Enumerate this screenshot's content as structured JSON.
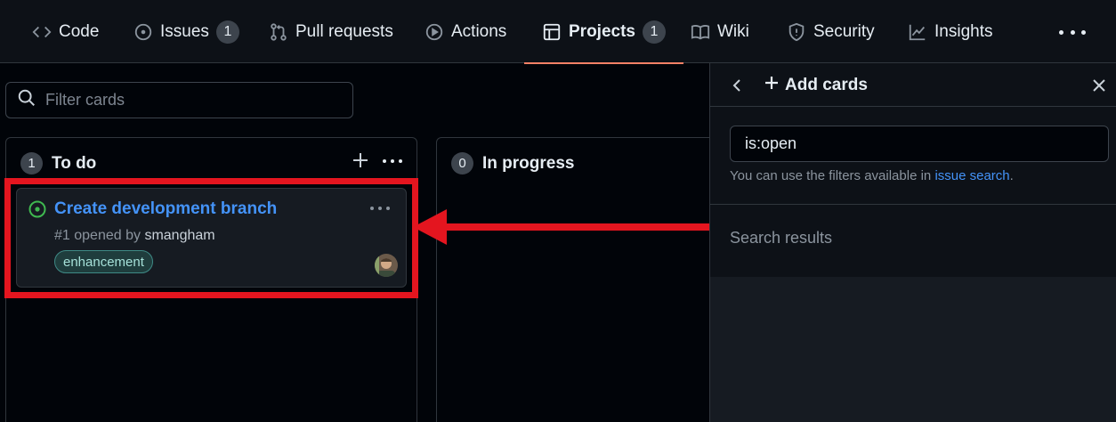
{
  "nav": {
    "tabs": [
      {
        "label": "Code",
        "icon": "code-icon"
      },
      {
        "label": "Issues",
        "icon": "issue-opened-icon",
        "count": "1"
      },
      {
        "label": "Pull requests",
        "icon": "git-pull-request-icon"
      },
      {
        "label": "Actions",
        "icon": "play-icon"
      },
      {
        "label": "Projects",
        "icon": "table-icon",
        "count": "1",
        "active": true
      },
      {
        "label": "Wiki",
        "icon": "book-icon"
      },
      {
        "label": "Security",
        "icon": "shield-icon"
      },
      {
        "label": "Insights",
        "icon": "graph-icon"
      }
    ],
    "active_underline_color": "#f78166"
  },
  "filter": {
    "placeholder": "Filter cards"
  },
  "columns": [
    {
      "count": "1",
      "name": "To do",
      "cards": [
        {
          "title": "Create development branch",
          "number_text": "#1 opened by",
          "author": "smangham",
          "label": "enhancement"
        }
      ]
    },
    {
      "count": "0",
      "name": "In progress"
    }
  ],
  "panel": {
    "title": "Add cards",
    "search_value": "is:open",
    "hint_prefix": "You can use the filters available in",
    "hint_link": "issue search",
    "hint_suffix": ".",
    "results_label": "Search results"
  },
  "colors": {
    "accent_link": "#4493f8",
    "highlight": "#e4151f",
    "open_status": "#3fb950"
  }
}
